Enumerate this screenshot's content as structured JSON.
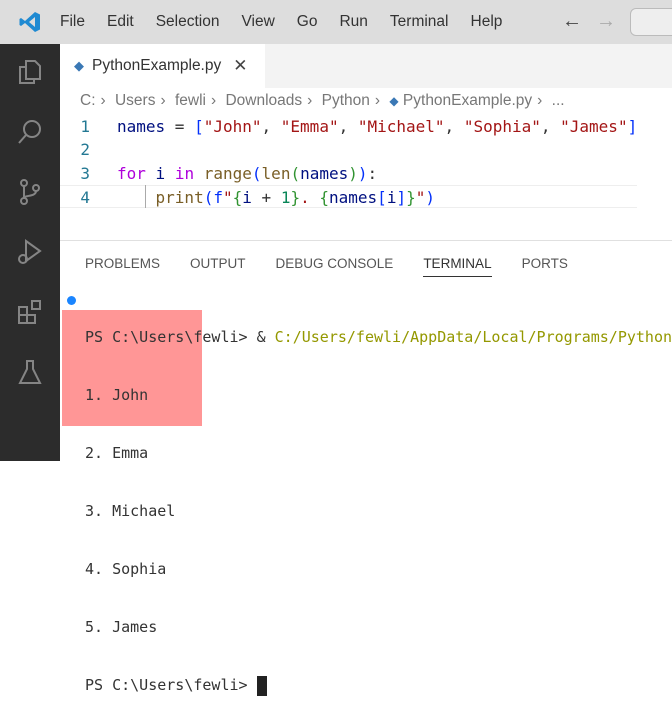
{
  "menu": [
    "File",
    "Edit",
    "Selection",
    "View",
    "Go",
    "Run",
    "Terminal",
    "Help"
  ],
  "nav": {
    "back": "←",
    "forward": "→"
  },
  "tab": {
    "label": "PythonExample.py",
    "close": "✕"
  },
  "breadcrumb": [
    "C:",
    "Users",
    "fewli",
    "Downloads",
    "Python",
    "PythonExample.py",
    "..."
  ],
  "code": {
    "line_numbers": [
      "1",
      "2",
      "3",
      "4"
    ]
  },
  "panel_tabs": [
    "PROBLEMS",
    "OUTPUT",
    "DEBUG CONSOLE",
    "TERMINAL",
    "PORTS"
  ],
  "terminal": {
    "prompt": "PS C:\\Users\\fewli> ",
    "amp": "& ",
    "command": "C:/Users/fewli/AppData/Local/Programs/Python/",
    "output": [
      "1. John",
      "2. Emma",
      "3. Michael",
      "4. Sophia",
      "5. James"
    ],
    "prompt2": "PS C:\\Users\\fewli> "
  }
}
